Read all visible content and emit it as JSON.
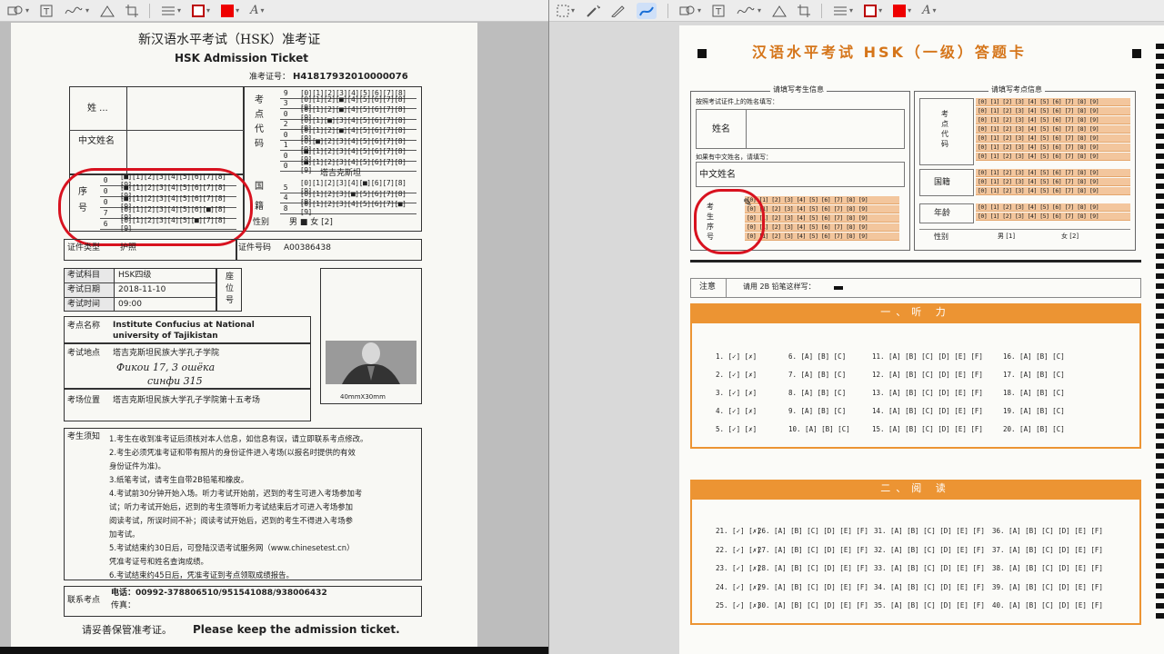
{
  "left_toolbar": {
    "icons": [
      "selection-icon",
      "shapes-icon",
      "text-icon",
      "sign-icon",
      "adjust-icon",
      "crop-icon",
      "line-style-icon",
      "border-color-icon",
      "fill-color-icon",
      "font-icon"
    ]
  },
  "right_toolbar": {
    "icons": [
      "selection-icon",
      "magic-wand-icon",
      "sketch-icon",
      "draw-icon",
      "shapes-icon",
      "text-icon",
      "sign-icon",
      "adjust-icon",
      "crop-icon",
      "line-style-icon",
      "border-color-icon",
      "fill-color-icon",
      "font-icon"
    ]
  },
  "ticket": {
    "title_cn": "新汉语水平考试（HSK）准考证",
    "title_en": "HSK Admission Ticket",
    "exam_no_label": "准考证号：",
    "exam_no": "H41817932010000076",
    "name_label": "姓 ...",
    "cn_name_label": "中文姓名",
    "center_label": "考点代码",
    "center_rows": [
      {
        "digit": "9",
        "bubbles": "[0][1][2][3][4][5][6][7][8]"
      },
      {
        "digit": "3",
        "bubbles": "[0][1][2][■][4][5][6][7][8][9]"
      },
      {
        "digit": "0",
        "bubbles": "[0][1][2][■][4][5][6][7][8][9]"
      },
      {
        "digit": "2",
        "bubbles": "[0][1][■][3][4][5][6][7][8][9]"
      },
      {
        "digit": "0",
        "bubbles": "[0][1][2][■][4][5][6][7][8][9]"
      },
      {
        "digit": "1",
        "bubbles": "[0][■][2][3][4][5][6][7][8][9]"
      },
      {
        "digit": "0",
        "bubbles": "[■][1][2][3][4][5][6][7][8][9]"
      },
      {
        "digit": "0",
        "bubbles": "[■][1][2][3][4][5][6][7][8][9]"
      }
    ],
    "country_label": "国籍",
    "country_value": "塔吉克斯坦",
    "country_rows": [
      {
        "digit": "5",
        "bubbles": "[0][1][2][3][4][■][6][7][8][9]"
      },
      {
        "digit": "4",
        "bubbles": "[0][1][2][3][■][5][6][7][8][9]"
      },
      {
        "digit": "8",
        "bubbles": "[0][1][2][3][4][5][6][7][■][9]"
      }
    ],
    "gender_label": "性别",
    "gender_value": "男 ■ 女 [2]",
    "seq_label": "序号",
    "seq_rows": [
      {
        "digit": "0",
        "bubbles": "[■][1][2][3][4][5][6][7][8][9]"
      },
      {
        "digit": "0",
        "bubbles": "[■][1][2][3][4][5][6][7][8][9]"
      },
      {
        "digit": "0",
        "bubbles": "[■][1][2][3][4][5][6][7][8][9]"
      },
      {
        "digit": "7",
        "bubbles": "[0][1][2][3][4][5][6][■][8][9]"
      },
      {
        "digit": "6",
        "bubbles": "[0][1][2][3][4][5][■][7][8][9]"
      }
    ],
    "id_type_label": "证件类型",
    "id_type_value": "护照",
    "id_no_label": "证件号码",
    "id_no_value": "A00386438",
    "subject_label": "考试科目",
    "subject_value": "HSK四级",
    "date_label": "考试日期",
    "date_value": "2018-11-10",
    "time_label": "考试时间",
    "time_value": "09:00",
    "seat_label": "座位号",
    "photo_caption": "40mmX30mm",
    "venue_label": "考点名称",
    "venue_value": "Institute Confucius at National university of Tajikistan",
    "addr_label": "考试地点",
    "addr_value": "塔吉克斯坦民族大学孔子学院",
    "addr_hand_1": "Фикои 17, 3 ошёка",
    "addr_hand_2": "синфи 315",
    "room_label": "考场位置",
    "room_value": "塔吉克斯坦民族大学孔子学院第十五考场",
    "notes_label": "考生须知",
    "notes": [
      "1.考生在收到准考证后须核对本人信息，如信息有误，请立即联系考点修改。",
      "2.考生必须凭准考证和带有照片的身份证件进入考场(以报名时提供的有效",
      "身份证件为准)。",
      "3.纸笔考试，请考生自带2B铅笔和橡皮。",
      "4.考试前30分钟开始入场。听力考试开始前，迟到的考生可进入考场参加考",
      "试；听力考试开始后，迟到的考生须等听力考试结束后才可进入考场参加",
      "阅读考试，所误时间不补；阅读考试开始后，迟到的考生不得进入考场参",
      "加考试。",
      "5.考试结束约30日后，可登陆汉语考试服务网（www.chinesetest.cn）",
      "凭准考证号和姓名查询成绩。",
      "6.考试结束约45日后，凭准考证到考点领取成绩报告。"
    ],
    "contact_label": "联系考点",
    "contact_phone": "电话：00992-378806510/951541088/938006432",
    "contact_fax": "传真：",
    "footer_cn": "请妥善保管准考证。",
    "footer_en": "Please keep the admission ticket."
  },
  "answer_sheet": {
    "title": "汉语水平考试 HSK（一级）答题卡",
    "left_section_title": "请填写考生信息",
    "left_instruction": "按照考试证件上的姓名填写：",
    "name_label": "姓名",
    "cn_name_hint": "如果有中文姓名，请填写：",
    "cn_name_label": "中文姓名",
    "seq_label": "考生序号",
    "seq_rows": [
      "[0] [1] [2] [3] [4] [5] [6] [7] [8] [9]",
      "[0] [1] [2] [3] [4] [5] [6] [7] [8] [9]",
      "[0] [1] [2] [3] [4] [5] [6] [7] [8] [9]",
      "[0] [1] [2] [3] [4] [5] [6] [7] [8] [9]",
      "[0] [1] [2] [3] [4] [5] [6] [7] [8] [9]"
    ],
    "right_section_title": "请填写考点信息",
    "center_label": "考点代码",
    "center_rows": [
      "[0] [1] [2] [3] [4] [5] [6] [7] [8] [9]",
      "[0] [1] [2] [3] [4] [5] [6] [7] [8] [9]",
      "[0] [1] [2] [3] [4] [5] [6] [7] [8] [9]",
      "[0] [1] [2] [3] [4] [5] [6] [7] [8] [9]",
      "[0] [1] [2] [3] [4] [5] [6] [7] [8] [9]",
      "[0] [1] [2] [3] [4] [5] [6] [7] [8] [9]",
      "[0] [1] [2] [3] [4] [5] [6] [7] [8] [9]"
    ],
    "country_label": "国籍",
    "country_rows": [
      "[0] [1] [2] [3] [4] [5] [6] [7] [8] [9]",
      "[0] [1] [2] [3] [4] [5] [6] [7] [8] [9]",
      "[0] [1] [2] [3] [4] [5] [6] [7] [8] [9]"
    ],
    "age_label": "年龄",
    "age_rows": [
      "[0] [1] [2] [3] [4] [5] [6] [7] [8] [9]",
      "[0] [1] [2] [3] [4] [5] [6] [7] [8] [9]"
    ],
    "gender_label": "性别",
    "gender_male": "男  [1]",
    "gender_female": "女  [2]",
    "note_label": "注意",
    "note_text": "请用 2B 铅笔这样写：",
    "listening_title": "一、听 力",
    "listening": [
      [
        "1. [✓] [✗]",
        "6. [A] [B] [C]",
        "11. [A] [B] [C] [D] [E] [F]",
        "16. [A] [B] [C]"
      ],
      [
        "2. [✓] [✗]",
        "7. [A] [B] [C]",
        "12. [A] [B] [C] [D] [E] [F]",
        "17. [A] [B] [C]"
      ],
      [
        "3. [✓] [✗]",
        "8. [A] [B] [C]",
        "13. [A] [B] [C] [D] [E] [F]",
        "18. [A] [B] [C]"
      ],
      [
        "4. [✓] [✗]",
        "9. [A] [B] [C]",
        "14. [A] [B] [C] [D] [E] [F]",
        "19. [A] [B] [C]"
      ],
      [
        "5. [✓] [✗]",
        "10. [A] [B] [C]",
        "15. [A] [B] [C] [D] [E] [F]",
        "20. [A] [B] [C]"
      ]
    ],
    "reading_title": "二、阅 读",
    "reading": [
      [
        "21. [✓] [✗]",
        "26. [A] [B] [C] [D] [E] [F]",
        "31. [A] [B] [C] [D] [E] [F]",
        "36. [A] [B] [C] [D] [E] [F]"
      ],
      [
        "22. [✓] [✗]",
        "27. [A] [B] [C] [D] [E] [F]",
        "32. [A] [B] [C] [D] [E] [F]",
        "37. [A] [B] [C] [D] [E] [F]"
      ],
      [
        "23. [✓] [✗]",
        "28. [A] [B] [C] [D] [E] [F]",
        "33. [A] [B] [C] [D] [E] [F]",
        "38. [A] [B] [C] [D] [E] [F]"
      ],
      [
        "24. [✓] [✗]",
        "29. [A] [B] [C] [D] [E] [F]",
        "34. [A] [B] [C] [D] [E] [F]",
        "39. [A] [B] [C] [D] [E] [F]"
      ],
      [
        "25. [✓] [✗]",
        "30. [A] [B] [C] [D] [E] [F]",
        "35. [A] [B] [C] [D] [E] [F]",
        "40. [A] [B] [C] [D] [E] [F]"
      ]
    ]
  },
  "colors": {
    "accent_orange": "#ec9433",
    "highlight": "#f3c69d",
    "annotation_red": "#d8121f"
  }
}
